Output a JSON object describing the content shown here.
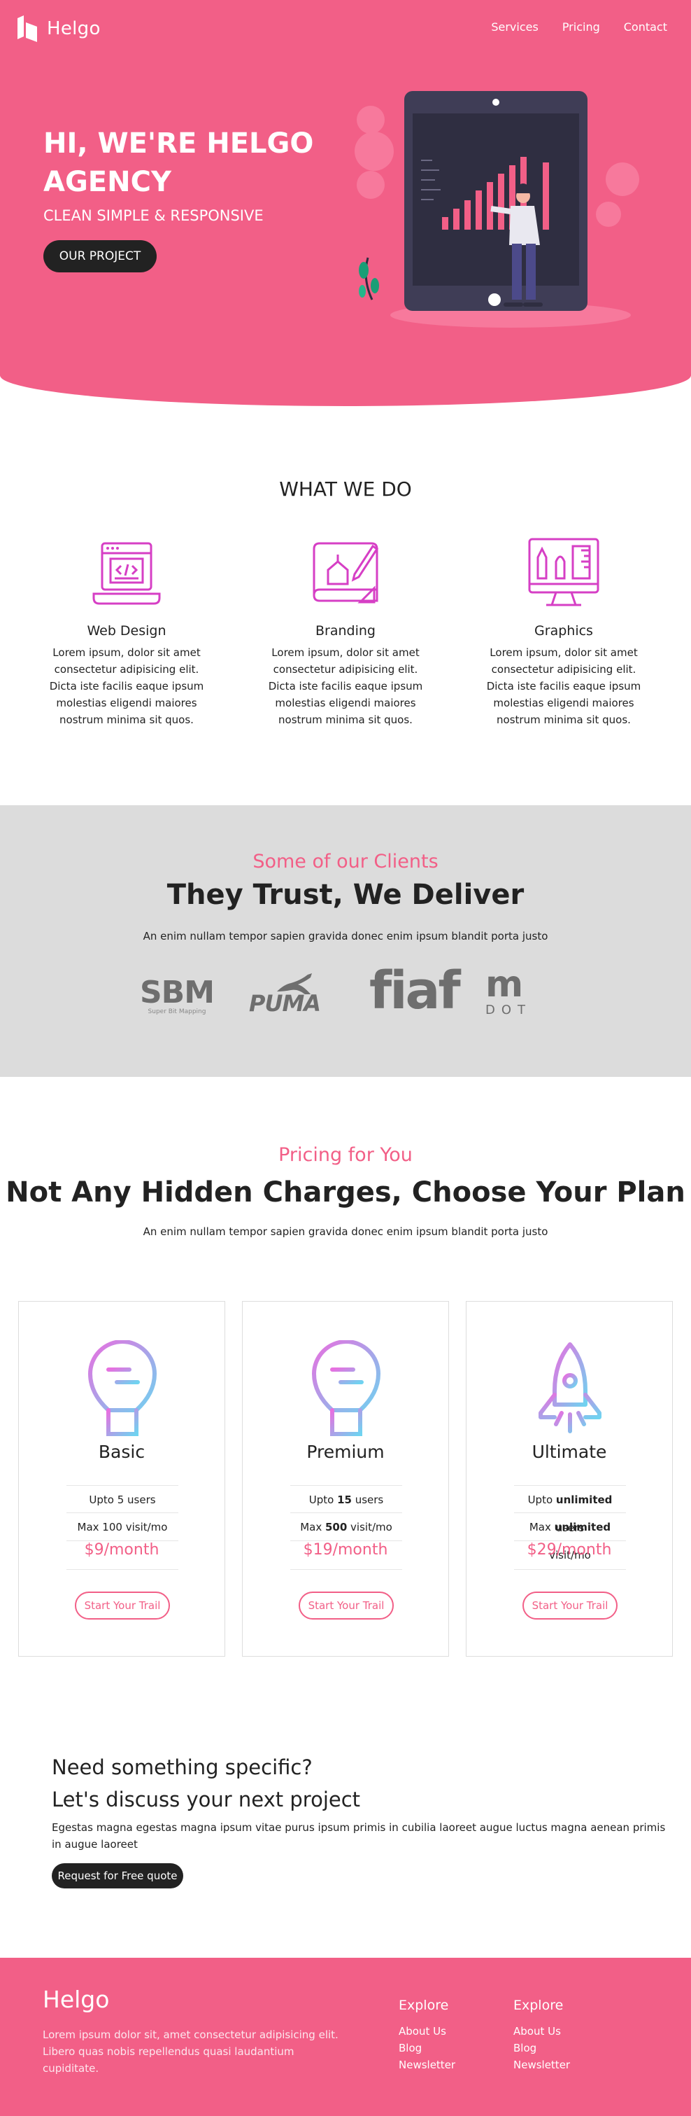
{
  "brand": {
    "name": "Helgo",
    "accent": "#f25f87",
    "dark": "#222222"
  },
  "nav": {
    "links": [
      "Services",
      "Pricing",
      "Contact"
    ]
  },
  "hero": {
    "title": "HI, WE'RE HELGO AGENCY",
    "subtitle": "CLEAN SIMPLE & RESPONSIVE",
    "button": "OUR PROJECT"
  },
  "services": {
    "title": "WHAT WE DO",
    "items": [
      {
        "icon": "web-design-icon",
        "name": "Web Design",
        "text": "Lorem ipsum, dolor sit amet consectetur adipisicing elit. Dicta iste facilis eaque ipsum molestias eligendi maiores nostrum minima sit quos."
      },
      {
        "icon": "branding-icon",
        "name": "Branding",
        "text": "Lorem ipsum, dolor sit amet consectetur adipisicing elit. Dicta iste facilis eaque ipsum molestias eligendi maiores nostrum minima sit quos."
      },
      {
        "icon": "graphics-icon",
        "name": "Graphics",
        "text": "Lorem ipsum, dolor sit amet consectetur adipisicing elit. Dicta iste facilis eaque ipsum molestias eligendi maiores nostrum minima sit quos."
      }
    ]
  },
  "clients": {
    "eyebrow": "Some of our Clients",
    "title": "They Trust, We Deliver",
    "lead": "An enim nullam tempor sapien gravida donec enim ipsum blandit porta justo",
    "logos": [
      {
        "name": "SBM",
        "sub": "Super Bit Mapping"
      },
      {
        "name": "PUMA"
      },
      {
        "name": "fiaf"
      },
      {
        "name": "m",
        "sub": "DOT"
      }
    ]
  },
  "pricing": {
    "eyebrow": "Pricing for You",
    "title": "Not Any Hidden Charges, Choose Your Plan",
    "lead": "An enim nullam tempor sapien gravida donec enim ipsum blandit porta justo",
    "plans": [
      {
        "icon": "lightbulb-icon",
        "name": "Basic",
        "users": {
          "pre": "Upto ",
          "bold": "5",
          "post": " users",
          "boldStyle": "normal"
        },
        "visits": {
          "pre": "Max ",
          "bold": "100",
          "post": " visit/mo",
          "boldStyle": "normal"
        },
        "price": "$9/month",
        "button": "Start Your Trail"
      },
      {
        "icon": "lightbulb-icon",
        "name": "Premium",
        "users": {
          "pre": "Upto ",
          "bold": "15",
          "post": " users",
          "boldStyle": "bold"
        },
        "visits": {
          "pre": "Max ",
          "bold": "500",
          "post": " visit/mo",
          "boldStyle": "bold"
        },
        "price": "$19/month",
        "button": "Start Your Trail"
      },
      {
        "icon": "rocket-icon",
        "name": "Ultimate",
        "users": {
          "pre": "Upto ",
          "bold": "unlimited",
          "post": " users",
          "boldStyle": "bold"
        },
        "visits": {
          "pre": "Max ",
          "bold": "unlimited",
          "post": " visit/mo",
          "boldStyle": "bold"
        },
        "price": "$29/month",
        "button": "Start Your Trail"
      }
    ]
  },
  "cta": {
    "line1": "Need something specific?",
    "line2": "Let's discuss your next project",
    "text": "Egestas magna egestas magna ipsum vitae purus ipsum primis in cubilia laoreet augue luctus magna aenean primis in augue laoreet",
    "button": "Request for Free quote"
  },
  "footer": {
    "logo": "Helgo",
    "desc": "Lorem ipsum dolor sit, amet consectetur adipisicing elit. Libero quas nobis repellendus quasi laudantium cupiditate.",
    "columns": [
      {
        "title": "Explore",
        "links": [
          "About Us",
          "Blog",
          "Newsletter"
        ]
      },
      {
        "title": "Explore",
        "links": [
          "About Us",
          "Blog",
          "Newsletter"
        ]
      }
    ]
  }
}
